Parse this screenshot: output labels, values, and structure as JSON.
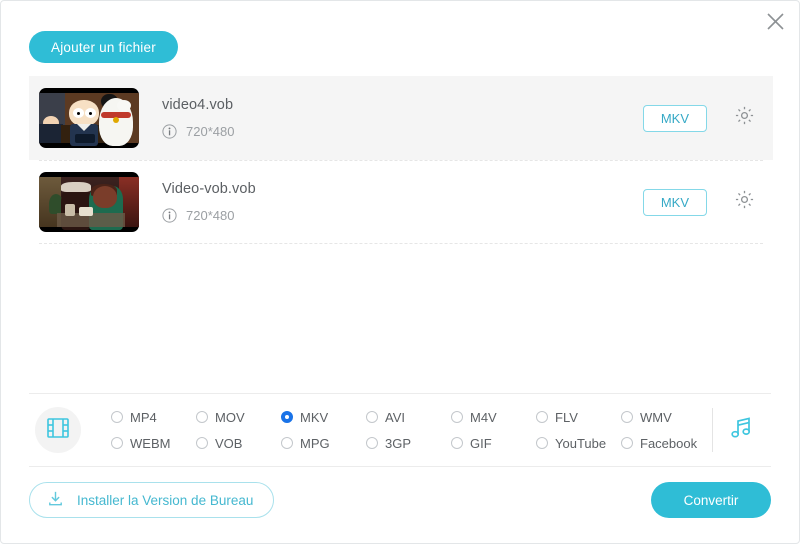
{
  "window": {
    "close_label": "close-icon"
  },
  "toolbar": {
    "add_file_label": "Ajouter un fichier"
  },
  "files": [
    {
      "name": "video4.vob",
      "resolution": "720*480",
      "format_tag": "MKV",
      "selected": true
    },
    {
      "name": "Video-vob.vob",
      "resolution": "720*480",
      "format_tag": "MKV",
      "selected": false
    }
  ],
  "format_bar": {
    "video_icon": "film-strip-icon",
    "audio_icon": "music-note-icon",
    "options": [
      {
        "label": "MP4",
        "checked": false
      },
      {
        "label": "MOV",
        "checked": false
      },
      {
        "label": "MKV",
        "checked": true
      },
      {
        "label": "AVI",
        "checked": false
      },
      {
        "label": "M4V",
        "checked": false
      },
      {
        "label": "FLV",
        "checked": false
      },
      {
        "label": "WMV",
        "checked": false
      },
      {
        "label": "WEBM",
        "checked": false
      },
      {
        "label": "VOB",
        "checked": false
      },
      {
        "label": "MPG",
        "checked": false
      },
      {
        "label": "3GP",
        "checked": false
      },
      {
        "label": "GIF",
        "checked": false
      },
      {
        "label": "YouTube",
        "checked": false
      },
      {
        "label": "Facebook",
        "checked": false
      }
    ]
  },
  "footer": {
    "install_label": "Installer la Version de Bureau",
    "convert_label": "Convertir"
  },
  "colors": {
    "accent": "#2fbdd6",
    "radio_checked": "#1a73e8",
    "tag_border": "#84d8e8",
    "tag_text": "#36a9c6"
  }
}
